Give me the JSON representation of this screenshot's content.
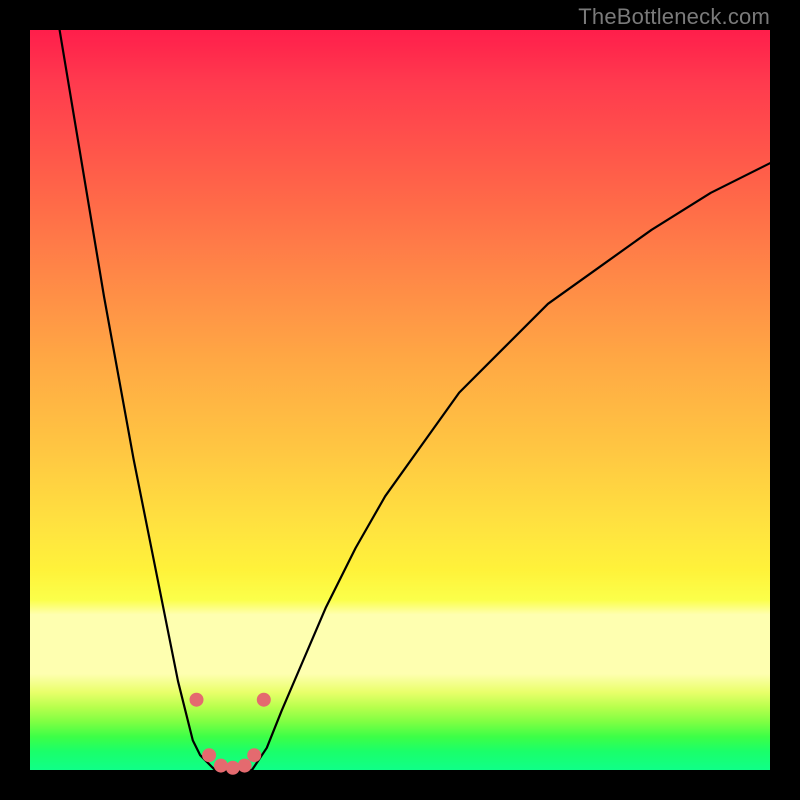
{
  "watermark": "TheBottleneck.com",
  "colors": {
    "frame": "#000000",
    "curve": "#000000",
    "dot": "#e46a6f"
  },
  "chart_data": {
    "type": "line",
    "title": "",
    "xlabel": "",
    "ylabel": "",
    "xlim": [
      0,
      100
    ],
    "ylim": [
      0,
      100
    ],
    "note": "Curves estimated from pixels; y is percent height from bottom of inner plot.",
    "series": [
      {
        "name": "left-branch",
        "x": [
          4,
          6,
          8,
          10,
          12,
          14,
          16,
          18,
          19,
          20,
          21,
          22,
          23,
          24,
          25
        ],
        "y": [
          100,
          88,
          76,
          64,
          53,
          42,
          32,
          22,
          17,
          12,
          8,
          4,
          2,
          1,
          0
        ]
      },
      {
        "name": "valley-flat",
        "x": [
          25,
          26,
          27,
          28,
          29,
          30
        ],
        "y": [
          0,
          0,
          0,
          0,
          0,
          0
        ]
      },
      {
        "name": "right-branch",
        "x": [
          30,
          32,
          34,
          37,
          40,
          44,
          48,
          53,
          58,
          64,
          70,
          77,
          84,
          92,
          100
        ],
        "y": [
          0,
          3,
          8,
          15,
          22,
          30,
          37,
          44,
          51,
          57,
          63,
          68,
          73,
          78,
          82
        ]
      }
    ],
    "markers": {
      "name": "valley-dots",
      "x": [
        22.5,
        24.2,
        25.8,
        27.4,
        29.0,
        30.3,
        31.6
      ],
      "y": [
        9.5,
        2.0,
        0.6,
        0.3,
        0.6,
        2.0,
        9.5
      ]
    }
  }
}
